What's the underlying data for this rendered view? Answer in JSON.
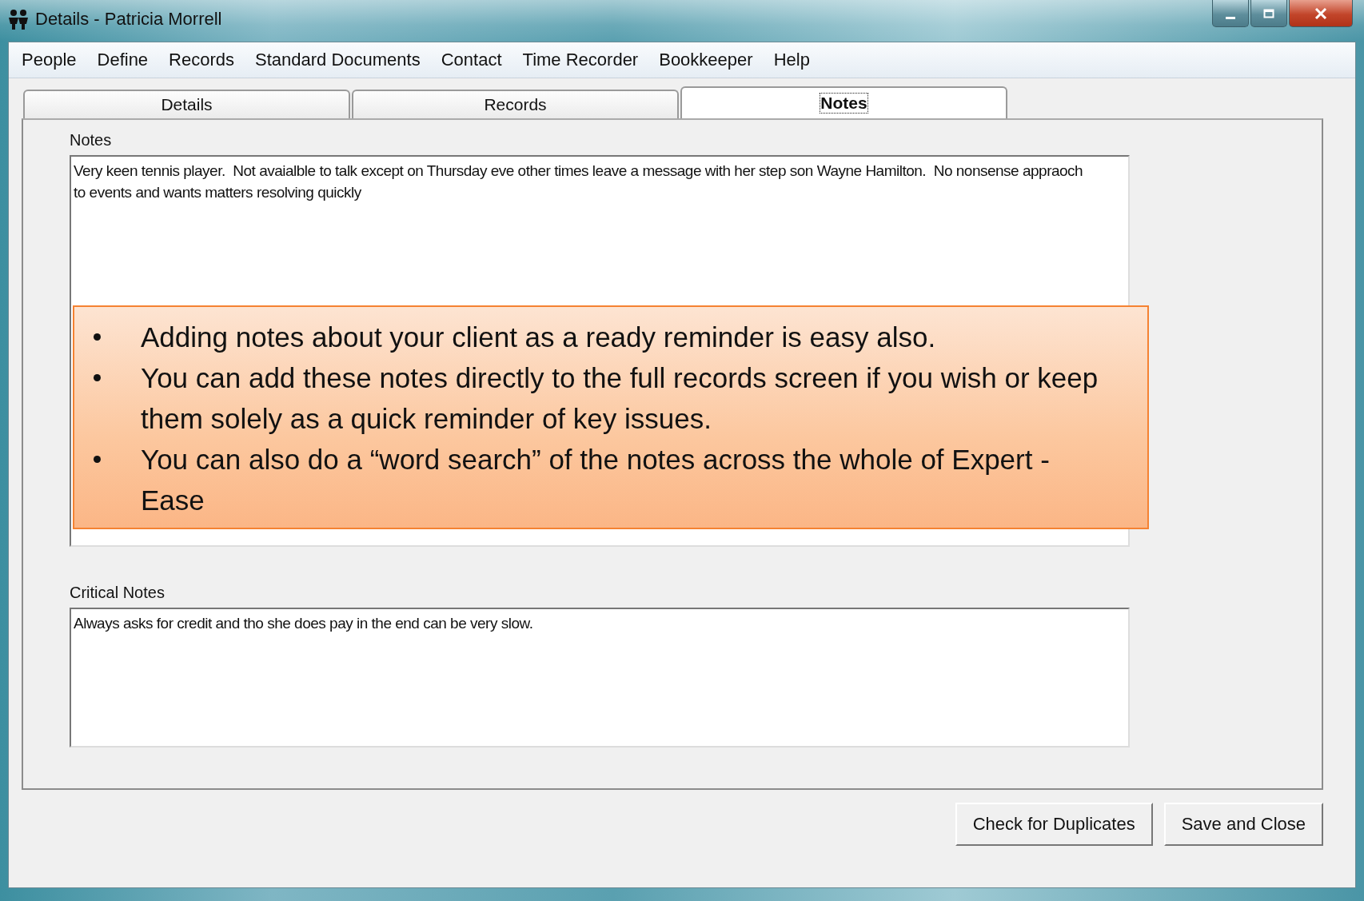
{
  "window": {
    "title": "Details - Patricia Morrell"
  },
  "menu": [
    "People",
    "Define",
    "Records",
    "Standard Documents",
    "Contact",
    "Time Recorder",
    "Bookkeeper",
    "Help"
  ],
  "tabs": [
    {
      "label": "Details",
      "selected": false
    },
    {
      "label": "Records",
      "selected": false
    },
    {
      "label": "Notes",
      "selected": true
    }
  ],
  "notes": {
    "label": "Notes",
    "value": "Very keen tennis player.  Not avaialble to talk except on Thursday eve other times leave a message with her step son Wayne Hamilton.  No nonsense appraoch to events and wants matters resolving quickly"
  },
  "critical_notes": {
    "label": "Critical Notes",
    "value": "Always asks for credit and tho she does pay in the end can be very slow."
  },
  "callout": {
    "bullets": [
      "Adding notes about your client as a ready reminder is easy also.",
      "You can add these notes directly to the full records screen if you wish or keep them solely as a quick reminder of key issues.",
      "You can also do a “word search” of the notes across the whole of Expert - Ease"
    ]
  },
  "buttons": [
    "Check for Duplicates",
    "Save and Close"
  ]
}
